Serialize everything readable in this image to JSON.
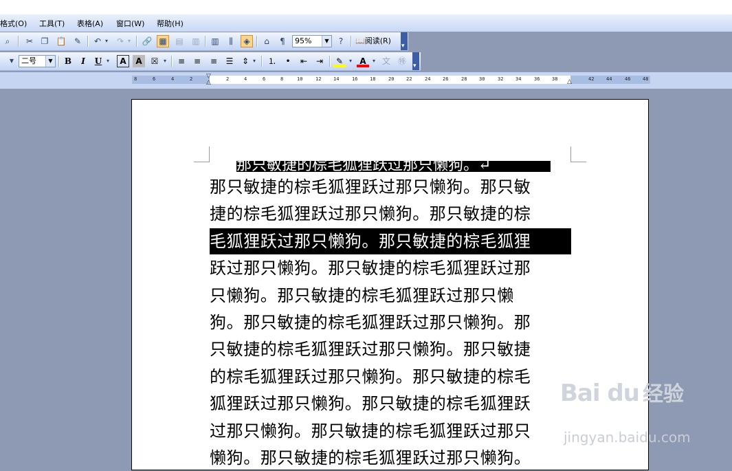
{
  "menubar": {
    "items": [
      "格式(O)",
      "工具(T)",
      "表格(A)",
      "窗口(W)",
      "帮助(H)"
    ]
  },
  "toolbar_standard": {
    "zoom_value": "95%",
    "read_label": "阅读(R)",
    "icons": [
      "research-icon",
      "cut-icon",
      "copy-icon",
      "paste-icon",
      "format-painter-icon",
      "undo-icon",
      "redo-icon",
      "hyperlink-icon",
      "tables-borders-icon",
      "insert-table-icon",
      "insert-excel-icon",
      "columns-icon",
      "drawing-icon",
      "document-map-icon",
      "show-hide-icon",
      "help-icon"
    ]
  },
  "toolbar_formatting": {
    "font_size": "二号",
    "bold_label": "B",
    "italic_label": "I",
    "underline_label": "U"
  },
  "ruler": {
    "left_ticks": [
      "8",
      "6",
      "4",
      "2"
    ],
    "right_ticks": [
      "2",
      "4",
      "6",
      "8",
      "10",
      "12",
      "14",
      "16",
      "18",
      "20",
      "22",
      "24",
      "26",
      "28",
      "30",
      "32",
      "34",
      "36",
      "38"
    ],
    "margin_ticks": [
      "42",
      "44",
      "46",
      "48"
    ]
  },
  "document": {
    "heading": "那只敏捷的棕毛狐狸跃过那只懒狗。↵",
    "lines": [
      "那只敏捷的棕毛狐狸跃过那只懒狗。那只敏",
      "捷的棕毛狐狸跃过那只懒狗。那只敏捷的棕",
      "毛狐狸跃过那只懒狗。那只敏捷的棕毛狐狸",
      "跃过那只懒狗。那只敏捷的棕毛狐狸跃过那",
      "只懒狗。那只敏捷的棕毛狐狸跃过那只懒",
      "狗。那只敏捷的棕毛狐狸跃过那只懒狗。那",
      "只敏捷的棕毛狐狸跃过那只懒狗。那只敏捷",
      "的棕毛狐狸跃过那只懒狗。那只敏捷的棕毛",
      "狐狸跃过那只懒狗。那只敏捷的棕毛狐狸跃",
      "过那只懒狗。那只敏捷的棕毛狐狸跃过那只",
      "懒狗。那只敏捷的棕毛狐狸跃过那只懒狗。"
    ],
    "selected_line_index": 2
  },
  "watermark": {
    "logo": "Bai du",
    "logo_cn": "经验",
    "url": "jingyan.baidu.com"
  }
}
